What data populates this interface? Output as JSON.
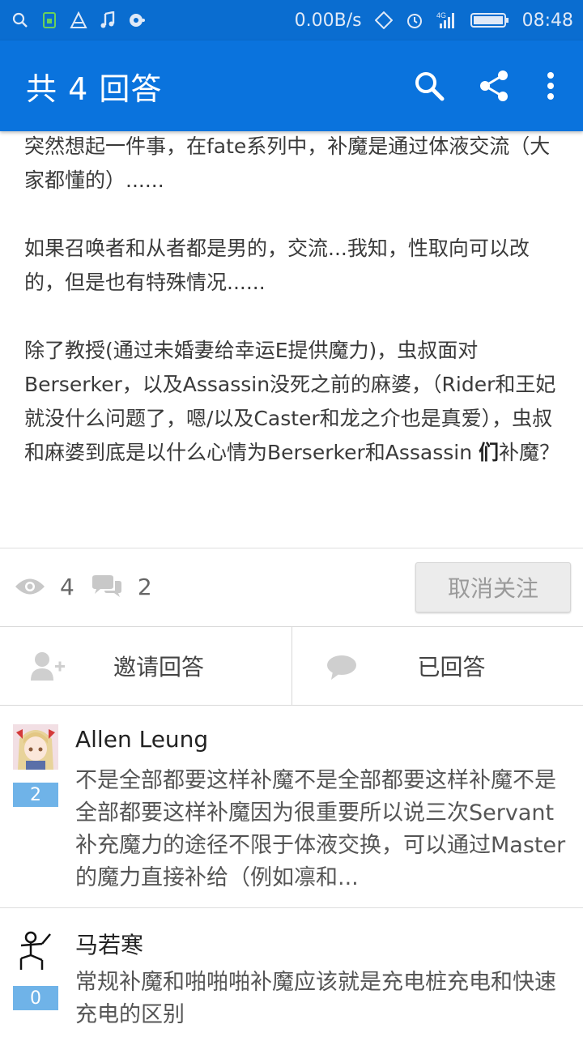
{
  "status_bar": {
    "net_speed": "0.00B/s",
    "network": "4G",
    "time": "08:48",
    "icons": [
      "search-icon",
      "sim-icon",
      "triangle-icon",
      "music-icon",
      "media-icon",
      "rotate-icon",
      "alarm-icon",
      "signal-icon",
      "battery-icon"
    ]
  },
  "appbar": {
    "title": "共 4 回答",
    "actions": [
      "search-icon",
      "share-icon",
      "more-icon"
    ]
  },
  "question": {
    "p1": "突然想起一件事，在fate系列中，补魔是通过体液交流（大家都懂的）......",
    "p2": "如果召唤者和从者都是男的，交流...我知，性取向可以改的，但是也有特殊情况......",
    "p3_a": "除了教授(通过未婚妻给幸运E提供魔力)，虫叔面对Berserker，以及Assassin没死之前的麻婆，（Rider和王妃就没什么问题了，嗯/以及Caster和龙之介也是真爱），虫叔和麻婆到底是以什么心情为Berserker和Assassin ",
    "p3_bold": "们",
    "p3_b": "补魔？"
  },
  "stats": {
    "views": "4",
    "comments": "2",
    "unfollow_label": "取消关注"
  },
  "actions": {
    "invite_label": "邀请回答",
    "answered_label": "已回答"
  },
  "answers": [
    {
      "author": "Allen Leung",
      "votes": "2",
      "excerpt": "不是全部都要这样补魔不是全部都要这样补魔不是全部都要这样补魔因为很重要所以说三次Servant补充魔力的途径不限于体液交换，可以通过Master的魔力直接补给（例如凛和..."
    },
    {
      "author": "马若寒",
      "votes": "0",
      "excerpt": "常规补魔和啪啪啪补魔应该就是充电桩充电和快速充电的区别"
    }
  ],
  "colors": {
    "appbar": "#0a73dd",
    "statusbar": "#0a6dd0",
    "vote_badge": "#6fb3e8"
  }
}
